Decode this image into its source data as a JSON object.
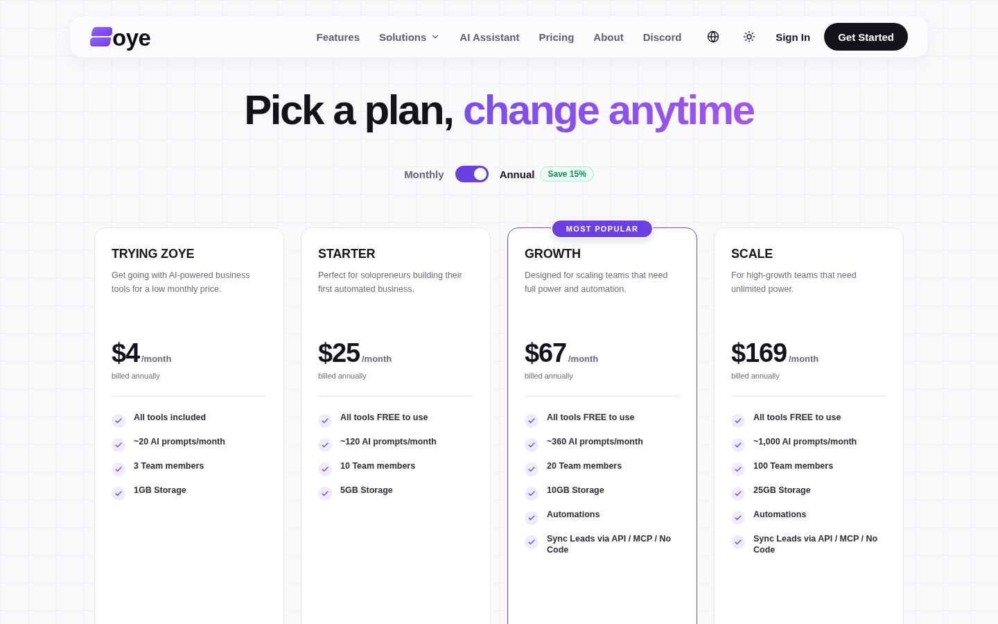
{
  "nav": {
    "logo": {
      "text": "oye"
    },
    "links": [
      {
        "label": "Features",
        "kind": "link"
      },
      {
        "label": "Solutions",
        "kind": "dropdown"
      },
      {
        "label": "AI Assistant",
        "kind": "link"
      },
      {
        "label": "Pricing",
        "kind": "link"
      },
      {
        "label": "About",
        "kind": "link"
      },
      {
        "label": "Discord",
        "kind": "link"
      }
    ],
    "sign_in": "Sign In",
    "cta": "Get Started"
  },
  "hero": {
    "title": "Pick a plan,",
    "title_highlight": "change anytime"
  },
  "billing": {
    "options": [
      {
        "label": "Monthly",
        "selected": false
      },
      {
        "label": "Annual",
        "selected": true
      }
    ],
    "toggle_on": true,
    "badge": "Save 15%"
  },
  "plans": [
    {
      "name": "TRYING ZOYE",
      "description": "Get going with AI-powered business tools for a low monthly price.",
      "price": "$4",
      "period": "/month",
      "note": "billed annually",
      "featured": false,
      "features": [
        "All tools included",
        "~20 AI prompts/month",
        "3 Team members",
        "1GB Storage"
      ]
    },
    {
      "name": "STARTER",
      "description": "Perfect for solopreneurs building their first automated business.",
      "price": "$25",
      "period": "/month",
      "note": "billed annually",
      "featured": false,
      "features": [
        "All tools FREE to use",
        "~120 AI prompts/month",
        "10 Team members",
        "5GB Storage"
      ]
    },
    {
      "name": "GROWTH",
      "description": "Designed for scaling teams that need full power and automation.",
      "price": "$67",
      "period": "/month",
      "note": "billed annually",
      "featured": true,
      "badge": "MOST POPULAR",
      "features": [
        "All tools FREE to use",
        "~360 AI prompts/month",
        "20 Team members",
        "10GB Storage",
        "Automations",
        "Sync Leads via API / MCP / No Code"
      ]
    },
    {
      "name": "SCALE",
      "description": "For high-growth teams that need unlimited power.",
      "price": "$169",
      "period": "/month",
      "note": "billed annually",
      "featured": false,
      "features": [
        "All tools FREE to use",
        "~1,000 AI prompts/month",
        "100 Team members",
        "25GB Storage",
        "Automations",
        "Sync Leads via API / MCP / No Code"
      ]
    }
  ]
}
